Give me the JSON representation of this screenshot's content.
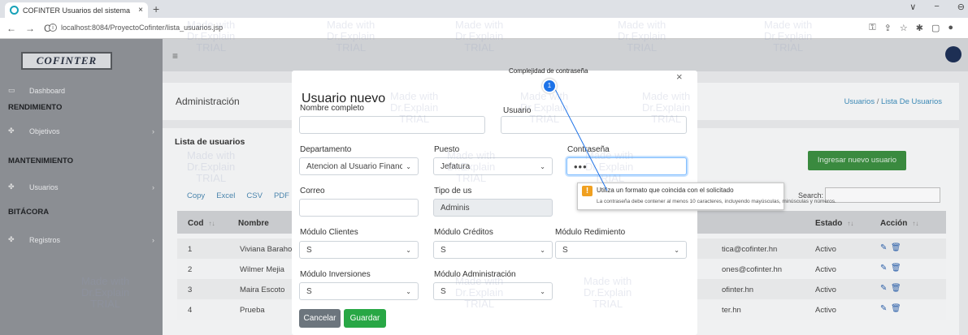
{
  "browser": {
    "tab_title": "COFINTER Usuarios del sistema",
    "tab_close": "×",
    "new_tab": "+",
    "url": "localhost:8084/ProyectoCofinter/lista_usuarios.jsp",
    "nav_back": "←",
    "nav_forward": "→",
    "nav_reload": "C",
    "win_minimize": "−",
    "win_maximize": "⊖",
    "win_chevron": "∨"
  },
  "app": {
    "logo": "COFINTER",
    "sidebar": {
      "dashboard": "Dashboard",
      "section_rendimiento": "RENDIMIENTO",
      "objetivos": "Objetivos",
      "section_mantenimiento": "MANTENIMIENTO",
      "usuarios": "Usuarios",
      "section_bitacora": "BITÁCORA",
      "registros": "Registros"
    },
    "header": {
      "title": "Administración",
      "breadcrumb_1": "Usuarios",
      "breadcrumb_sep": "/",
      "breadcrumb_2": "Lista De Usuarios"
    },
    "list": {
      "title": "Lista de usuarios",
      "new_button": "Ingresar nuevo usuario",
      "exports": [
        "Copy",
        "Excel",
        "CSV",
        "PDF"
      ],
      "search_label": "Search:",
      "columns": {
        "cod": "Cod",
        "nombre": "Nombre",
        "estado": "Estado",
        "accion": "Acción"
      },
      "rows": [
        {
          "cod": "1",
          "nombre": "Viviana Baraho",
          "email": "tica@cofinter.hn",
          "estado": "Activo"
        },
        {
          "cod": "2",
          "nombre": "Wilmer Mejia",
          "email": "ones@cofinter.hn",
          "estado": "Activo"
        },
        {
          "cod": "3",
          "nombre": "Maira Escoto",
          "email": "ofinter.hn",
          "estado": "Activo"
        },
        {
          "cod": "4",
          "nombre": "Prueba",
          "email": "ter.hn",
          "estado": "Activo"
        }
      ]
    }
  },
  "modal": {
    "title": "Usuario nuevo",
    "close": "×",
    "labels": {
      "nombre": "Nombre completo",
      "usuario": "Usuario",
      "departamento": "Departamento",
      "puesto": "Puesto",
      "contrasena": "Contraseña",
      "correo": "Correo",
      "tipo": "Tipo de us",
      "mod_clientes": "Módulo Clientes",
      "mod_creditos": "Módulo Créditos",
      "mod_rendimiento": "Módulo Redimiento",
      "mod_inversiones": "Módulo Inversiones",
      "mod_admin": "Módulo Administración"
    },
    "values": {
      "nombre": "",
      "usuario": "",
      "departamento": "Atencion al Usuario Financ",
      "puesto": "Jefatura",
      "contrasena": "•••",
      "correo": "",
      "tipo": "Adminis",
      "mod_clientes": "S",
      "mod_creditos": "S",
      "mod_rendimiento": "S",
      "mod_inversiones": "S",
      "mod_admin": "S"
    },
    "cancel": "Cancelar",
    "save": "Guardar"
  },
  "tooltip": {
    "icon": "!",
    "title": "Utiliza un formato que coincida con el solicitado",
    "detail": "La contraseña debe contener al menos 10 caracteres, incluyendo mayúsculas, minúsculas y números."
  },
  "annotation": {
    "label": "Complejidad de contraseña",
    "number": "1"
  },
  "watermark": "Made with\nDr.Explain\nTRIAL",
  "colors": {
    "accent_green": "#28a745",
    "link_blue": "#3a88b5",
    "annotation_blue": "#1e73e8"
  }
}
